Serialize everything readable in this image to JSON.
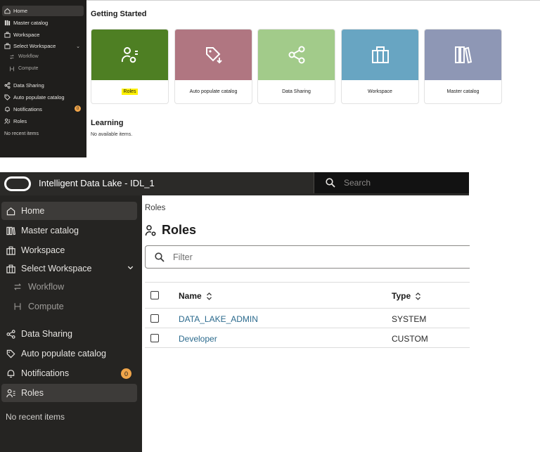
{
  "top": {
    "sidebar": {
      "items": [
        {
          "label": "Home",
          "icon": "home-icon"
        },
        {
          "label": "Master catalog",
          "icon": "catalog-icon"
        },
        {
          "label": "Workspace",
          "icon": "workspace-icon"
        },
        {
          "label": "Select Workspace",
          "icon": "workspace-icon"
        },
        {
          "label": "Workflow",
          "icon": "workflow-icon"
        },
        {
          "label": "Compute",
          "icon": "compute-icon"
        },
        {
          "label": "Data Sharing",
          "icon": "share-icon"
        },
        {
          "label": "Auto populate catalog",
          "icon": "tag-icon"
        },
        {
          "label": "Notifications",
          "icon": "bell-icon"
        },
        {
          "label": "Roles",
          "icon": "roles-icon"
        }
      ],
      "notifications_badge": "0",
      "recent": "No recent items"
    },
    "getting_started": "Getting Started",
    "cards": [
      {
        "label": "Roles",
        "color": "#4e7f23",
        "icon": "roles-icon"
      },
      {
        "label": "Auto populate catalog",
        "color": "#b07681",
        "icon": "tag-icon"
      },
      {
        "label": "Data Sharing",
        "color": "#a2cb8a",
        "icon": "share-icon"
      },
      {
        "label": "Workspace",
        "color": "#68a5c2",
        "icon": "workspace-icon"
      },
      {
        "label": "Master catalog",
        "color": "#8e97b5",
        "icon": "catalog-icon"
      }
    ],
    "learning": "Learning",
    "learning_empty": "No available items."
  },
  "bottom": {
    "header": {
      "title": "Intelligent Data Lake - IDL_1",
      "search_placeholder": "Search"
    },
    "sidebar": {
      "items": [
        {
          "label": "Home",
          "icon": "home-icon"
        },
        {
          "label": "Master catalog",
          "icon": "catalog-icon"
        },
        {
          "label": "Workspace",
          "icon": "workspace-icon"
        },
        {
          "label": "Select Workspace",
          "icon": "workspace-icon"
        },
        {
          "label": "Workflow",
          "icon": "workflow-icon"
        },
        {
          "label": "Compute",
          "icon": "compute-icon"
        },
        {
          "label": "Data Sharing",
          "icon": "share-icon"
        },
        {
          "label": "Auto populate catalog",
          "icon": "tag-icon"
        },
        {
          "label": "Notifications",
          "icon": "bell-icon"
        },
        {
          "label": "Roles",
          "icon": "roles-icon"
        }
      ],
      "notifications_badge": "0",
      "recent": "No recent items"
    },
    "breadcrumb": "Roles",
    "page_title": "Roles",
    "filter_placeholder": "Filter",
    "table": {
      "columns": [
        "Name",
        "Type"
      ],
      "rows": [
        {
          "name": "DATA_LAKE_ADMIN",
          "type": "SYSTEM"
        },
        {
          "name": "Developer",
          "type": "CUSTOM"
        }
      ]
    }
  }
}
